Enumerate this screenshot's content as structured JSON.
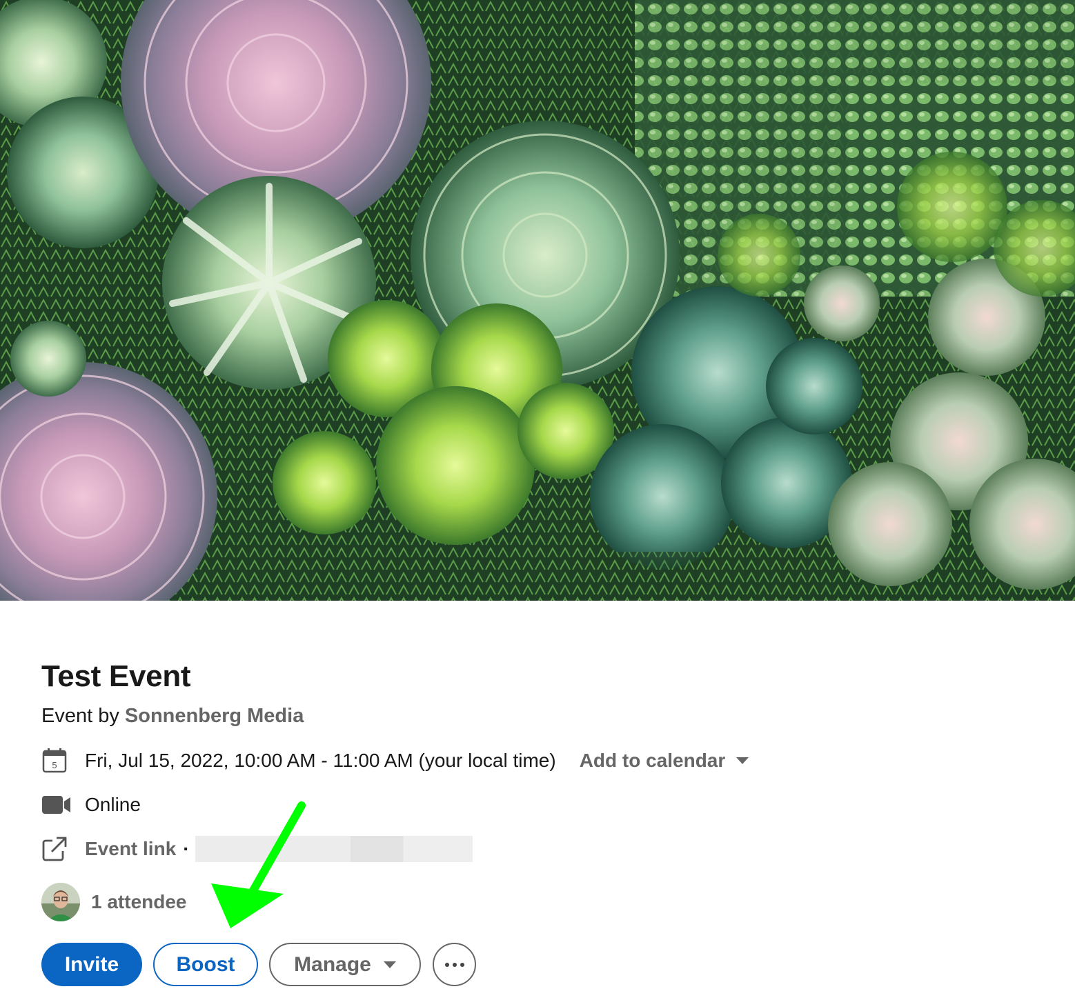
{
  "banner": {
    "image": "succulent-garden-photo"
  },
  "event": {
    "title": "Test Event",
    "byline_prefix": "Event by",
    "organizer": "Sonnenberg Media",
    "datetime": "Fri, Jul 15, 2022, 10:00 AM - 11:00 AM (your local time)",
    "calendar_day": "5",
    "add_to_calendar": "Add to calendar",
    "location": "Online",
    "link_label": "Event link",
    "link_separator": "·",
    "attendees": "1 attendee"
  },
  "icons": {
    "calendar": "calendar-icon",
    "video": "video-camera-icon",
    "external_link": "external-link-icon",
    "more": "more-icon",
    "caret": "chevron-down-icon"
  },
  "actions": {
    "invite": "Invite",
    "boost": "Boost",
    "manage": "Manage"
  },
  "annotation": {
    "arrow_color": "#00ff00"
  },
  "colors": {
    "primary": "#0a66c2",
    "text": "#191919",
    "muted": "#666666"
  }
}
